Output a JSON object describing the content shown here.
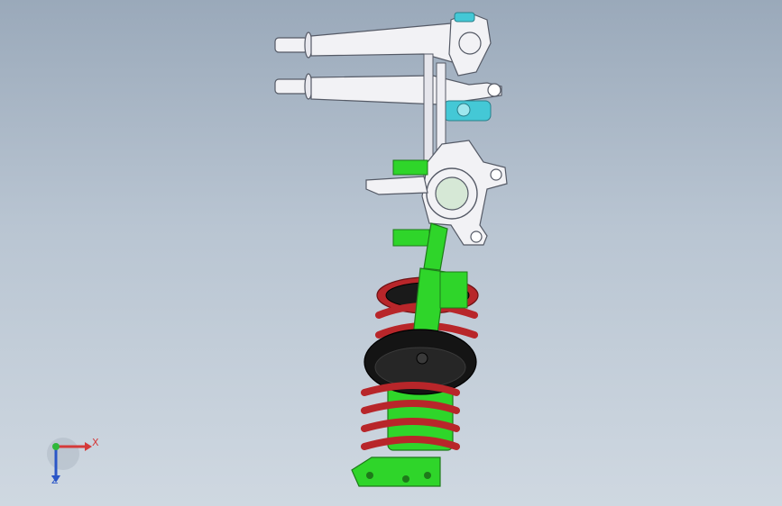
{
  "viewport": {
    "background_top": "#9aa9ba",
    "background_bottom": "#cfd8e1"
  },
  "model": {
    "parts": [
      "upper-control-arm",
      "lower-control-arm",
      "steering-knuckle",
      "strut-damper",
      "coil-spring",
      "spring-seat",
      "strut-mount-plate",
      "tie-rod"
    ],
    "colors": {
      "housing": "#f2f2f5",
      "outline": "#555a66",
      "damper": "#2fd52a",
      "spring": "#b8262a",
      "spring_seat": "#141414",
      "bushing": "#44c8d6"
    }
  },
  "triad": {
    "x_label": "X",
    "z_label": "Z",
    "x_color": "#d43a3a",
    "y_color": "#2fb83a",
    "z_color": "#2b56c7"
  }
}
